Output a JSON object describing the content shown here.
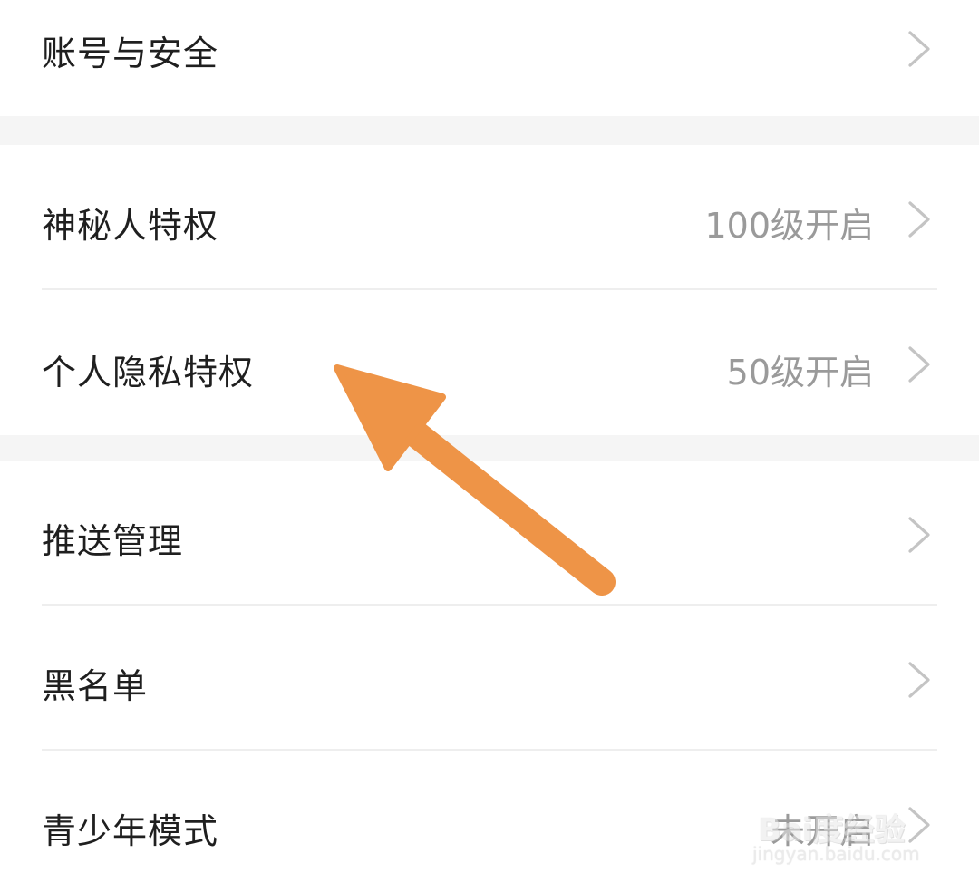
{
  "settings": {
    "items": [
      {
        "label": "账号与安全",
        "value": ""
      },
      {
        "label": "神秘人特权",
        "value": "100级开启"
      },
      {
        "label": "个人隐私特权",
        "value": "50级开启"
      },
      {
        "label": "推送管理",
        "value": ""
      },
      {
        "label": "黑名单",
        "value": ""
      },
      {
        "label": "青少年模式",
        "value": "未开启"
      }
    ]
  },
  "annotation": {
    "arrow_color": "#ee9447",
    "points_to": "个人隐私特权"
  },
  "watermark": {
    "brand": "Bai度经验",
    "url": "jingyan.baidu.com"
  },
  "icons": {
    "chevron": "chevron-right-icon"
  }
}
